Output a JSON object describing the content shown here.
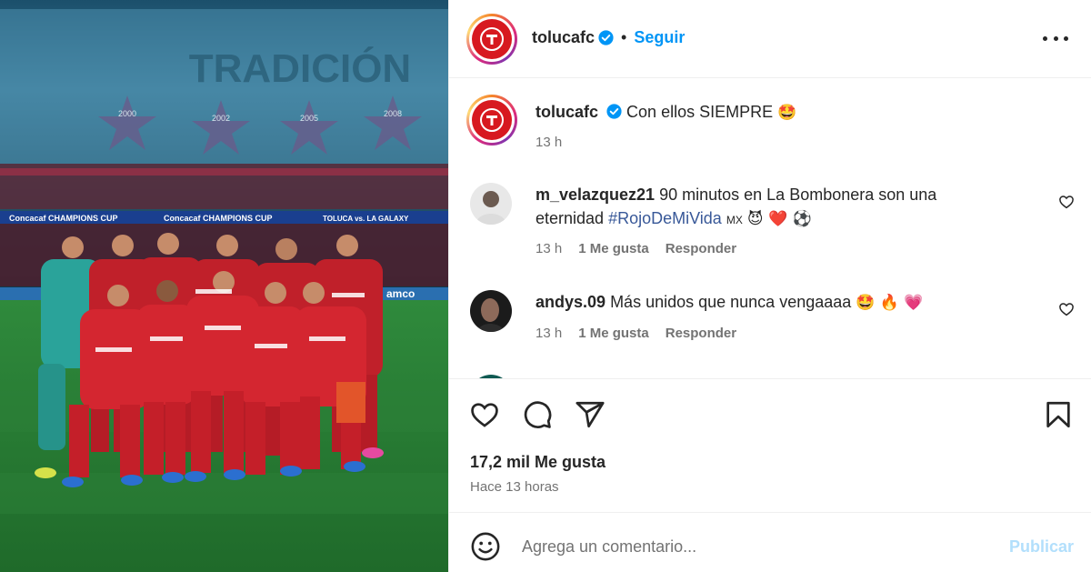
{
  "post": {
    "photo_alt_icons": "team-photo",
    "banner_text": "TRADICIÓN",
    "board_left": "Concacaf CHAMPIONS CUP",
    "board_right": "TOLUCA vs. LA GALAXY",
    "board_sponsor": "amco",
    "stand_years": [
      "2000",
      "2002",
      "2005",
      "2008"
    ]
  },
  "header": {
    "username": "tolucafc",
    "separator": "•",
    "follow_label": "Seguir",
    "more_icon": "more-horizontal-icon"
  },
  "caption": {
    "username": "tolucafc",
    "text": "Con ellos SIEMPRE",
    "emoji": "🤩",
    "time": "13 h"
  },
  "comments": [
    {
      "username": "m_velazquez21",
      "text_before": "90 minutos en La Bombonera son una eternidad",
      "hashtag": "#RojoDeMiVida",
      "flag": "MX",
      "emoji": "😈 ❤️ ⚽",
      "time": "13 h",
      "likes": "1 Me gusta",
      "reply": "Responder"
    },
    {
      "username": "andys.09",
      "text": "Más unidos que nunca vengaaaa",
      "emoji": "🤩 🔥 💗",
      "time": "13 h",
      "likes": "1 Me gusta",
      "reply": "Responder"
    }
  ],
  "actions": {
    "like_icon": "heart-icon",
    "comment_icon": "comment-icon",
    "share_icon": "send-icon",
    "save_icon": "bookmark-icon",
    "likes_count": "17,2 mil Me gusta",
    "posted": "Hace 13 horas"
  },
  "composer": {
    "placeholder": "Agrega un comentario...",
    "publish_label": "Publicar",
    "emoji_icon": "smiley-icon"
  },
  "colors": {
    "accent_blue": "#0095f6",
    "publish_disabled": "#b2dffc",
    "muted": "#737373",
    "toluca_red": "#d71920"
  }
}
